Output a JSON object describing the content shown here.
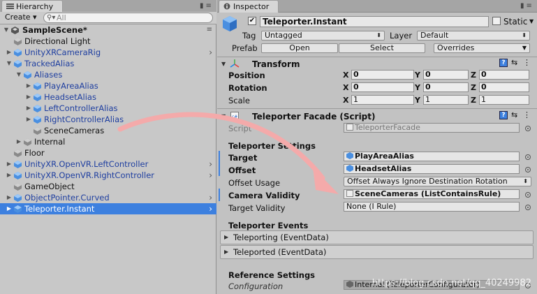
{
  "hierarchy": {
    "tab_label": "Hierarchy",
    "create_label": "Create",
    "search_placeholder": "All",
    "scene_name": "SampleScene*",
    "items": [
      {
        "label": "Directional Light",
        "depth": 1,
        "blue": false,
        "expander": "none",
        "chevron": false
      },
      {
        "label": "UnityXRCameraRig",
        "depth": 1,
        "blue": true,
        "expander": "closed",
        "chevron": true
      },
      {
        "label": "TrackedAlias",
        "depth": 1,
        "blue": true,
        "expander": "open",
        "chevron": false
      },
      {
        "label": "Aliases",
        "depth": 2,
        "blue": true,
        "expander": "open",
        "chevron": false
      },
      {
        "label": "PlayAreaAlias",
        "depth": 3,
        "blue": true,
        "expander": "closed",
        "chevron": false
      },
      {
        "label": "HeadsetAlias",
        "depth": 3,
        "blue": true,
        "expander": "closed",
        "chevron": false
      },
      {
        "label": "LeftControllerAlias",
        "depth": 3,
        "blue": true,
        "expander": "closed",
        "chevron": false
      },
      {
        "label": "RightControllerAlias",
        "depth": 3,
        "blue": true,
        "expander": "closed",
        "chevron": false
      },
      {
        "label": "SceneCameras",
        "depth": 3,
        "blue": false,
        "expander": "none",
        "chevron": false
      },
      {
        "label": "Internal",
        "depth": 2,
        "blue": false,
        "expander": "closed",
        "chevron": false
      },
      {
        "label": "Floor",
        "depth": 1,
        "blue": false,
        "expander": "none",
        "chevron": false
      },
      {
        "label": "UnityXR.OpenVR.LeftController",
        "depth": 1,
        "blue": true,
        "expander": "closed",
        "chevron": true
      },
      {
        "label": "UnityXR.OpenVR.RightController",
        "depth": 1,
        "blue": true,
        "expander": "closed",
        "chevron": true
      },
      {
        "label": "GameObject",
        "depth": 1,
        "blue": false,
        "expander": "none",
        "chevron": false
      },
      {
        "label": "ObjectPointer.Curved",
        "depth": 1,
        "blue": true,
        "expander": "closed",
        "chevron": true
      },
      {
        "label": "Teleporter.Instant",
        "depth": 1,
        "blue": true,
        "expander": "closed",
        "chevron": true,
        "selected": true
      }
    ]
  },
  "inspector": {
    "tab_label": "Inspector",
    "object_name": "Teleporter.Instant",
    "static_label": "Static",
    "tag_label": "Tag",
    "tag_value": "Untagged",
    "layer_label": "Layer",
    "layer_value": "Default",
    "prefab_label": "Prefab",
    "open_label": "Open",
    "select_label": "Select",
    "overrides_label": "Overrides",
    "transform": {
      "title": "Transform",
      "position_label": "Position",
      "rotation_label": "Rotation",
      "scale_label": "Scale",
      "position": [
        "0",
        "0",
        "0"
      ],
      "rotation": [
        "0",
        "0",
        "0"
      ],
      "scale": [
        "1",
        "1",
        "1"
      ]
    },
    "facade": {
      "title": "Teleporter Facade (Script)",
      "script_label": "Script",
      "script_value": "TeleporterFacade",
      "settings_header": "Teleporter Settings",
      "target_label": "Target",
      "target_value": "PlayAreaAlias",
      "offset_label": "Offset",
      "offset_value": "HeadsetAlias",
      "offset_usage_label": "Offset Usage",
      "offset_usage_value": "Offset Always Ignore Destination Rotation",
      "camera_validity_label": "Camera Validity",
      "camera_validity_value": "SceneCameras (ListContainsRule)",
      "target_validity_label": "Target Validity",
      "target_validity_value": "None (I Rule)",
      "events_header": "Teleporter Events",
      "teleporting_label": "Teleporting (EventData)",
      "teleported_label": "Teleported (EventData)",
      "reference_header": "Reference Settings",
      "configuration_label": "Configuration",
      "configuration_value": "Internal (TeleporterConfigurator)"
    }
  },
  "axis_labels": [
    "X",
    "Y",
    "Z"
  ],
  "watermark": "https://blog.csdn.net/qq_40249982",
  "colors": {
    "selection": "#3d80df",
    "prefab_text": "#1f3fa0",
    "arrow": "#f2a5a5"
  }
}
